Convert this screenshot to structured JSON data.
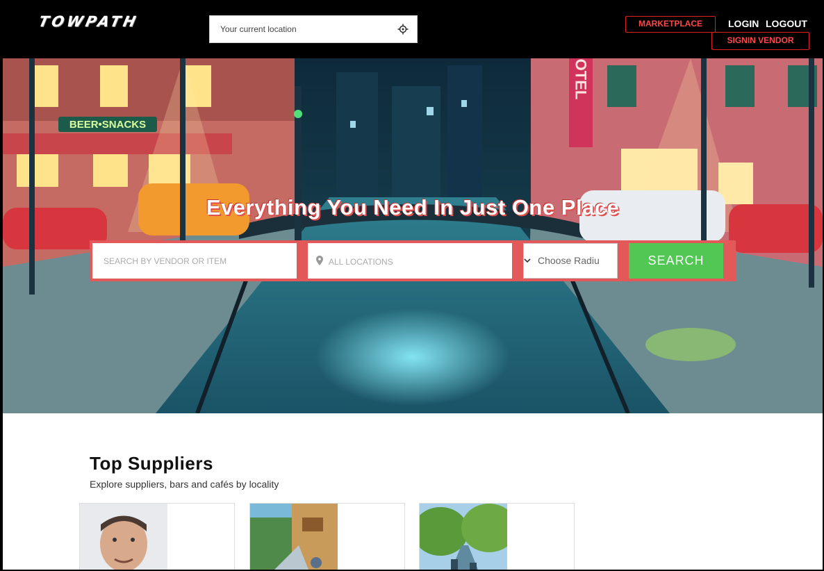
{
  "header": {
    "logo": "TOWPATH",
    "location_placeholder": "Your current location",
    "marketplace": "MARKETPLACE",
    "login": "LOGIN",
    "logout": "LOGOUT",
    "signin_vendor": "SIGNIN VENDOR"
  },
  "hero": {
    "title": "Everything You Need In Just One Place",
    "sign_beer": "BEER•SNACKS",
    "sign_hotel": "OTEL"
  },
  "search": {
    "vendor_placeholder": "SEARCH BY VENDOR OR ITEM",
    "location_placeholder": "ALL LOCATIONS",
    "radius_selected": "Choose Radiu",
    "button": "SEARCH"
  },
  "suppliers": {
    "title": "Top Suppliers",
    "subtitle": "Explore suppliers, bars and cafés by locality",
    "cards": [
      {
        "image": "portrait-photo"
      },
      {
        "image": "street-market-photo"
      },
      {
        "image": "canal-photo"
      }
    ]
  },
  "colors": {
    "accent_red": "#e35959",
    "search_green": "#52c754",
    "header_bg": "#000000"
  }
}
